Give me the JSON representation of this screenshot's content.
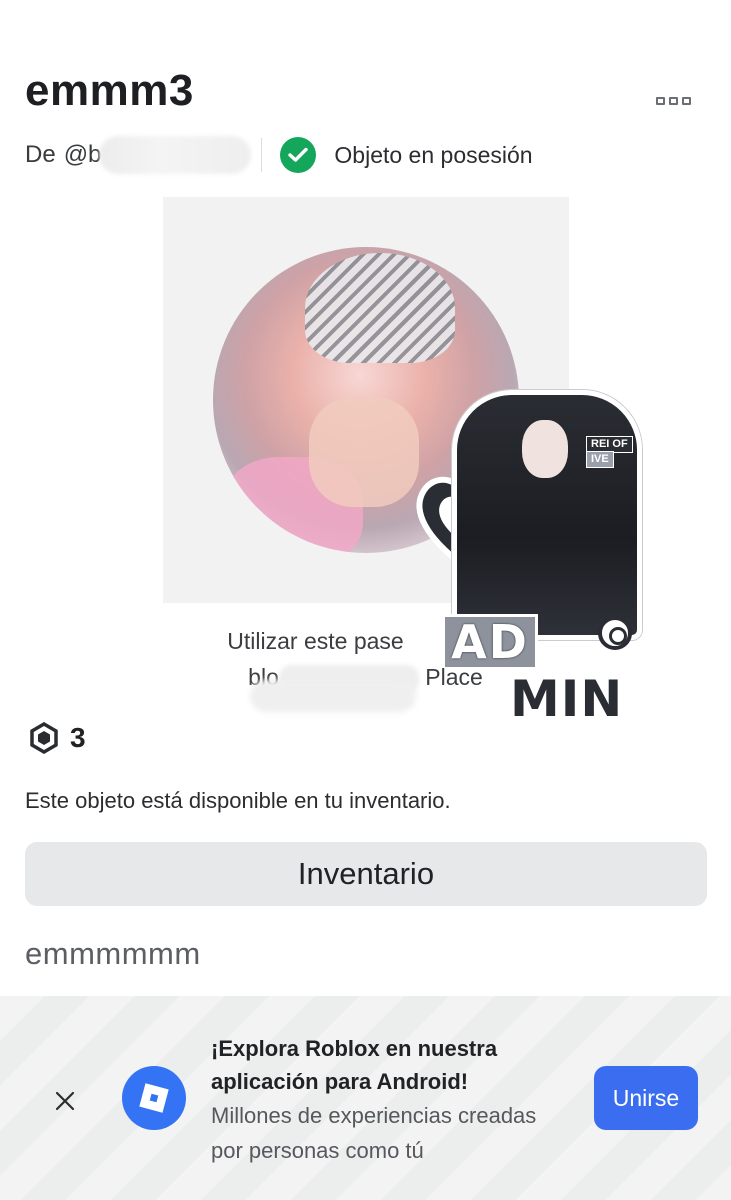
{
  "header": {
    "title": "emmm3",
    "more_icon": "ellipsis-icon"
  },
  "meta": {
    "creator_label": "De",
    "creator_handle_visible": "@b",
    "owned_icon": "check-circle-icon",
    "owned_text": "Objeto en posesión",
    "accent_green": "#14a65b"
  },
  "thumbnail": {
    "sticker_tag_1": "REI OF",
    "sticker_tag_2": "IVE",
    "sticker_ad": "AD",
    "sticker_min": "MIN"
  },
  "description_preview": {
    "line1": "Utilizar este pase",
    "line2_prefix": "blo",
    "line2_suffix": "Place"
  },
  "price": {
    "currency_icon": "robux-icon",
    "value": "3"
  },
  "availability_text": "Este objeto está disponible en tu inventario.",
  "inventory_button": {
    "label": "Inventario"
  },
  "description": "emmmmmm",
  "app_banner": {
    "title": "¡Explora Roblox en nuestra aplicación para Android!",
    "subtitle": "Millones de experiencias creadas por personas como tú",
    "join_label": "Unirse",
    "close_icon": "close-icon",
    "logo_icon": "roblox-logo-icon",
    "accent_blue": "#3a6df0"
  }
}
